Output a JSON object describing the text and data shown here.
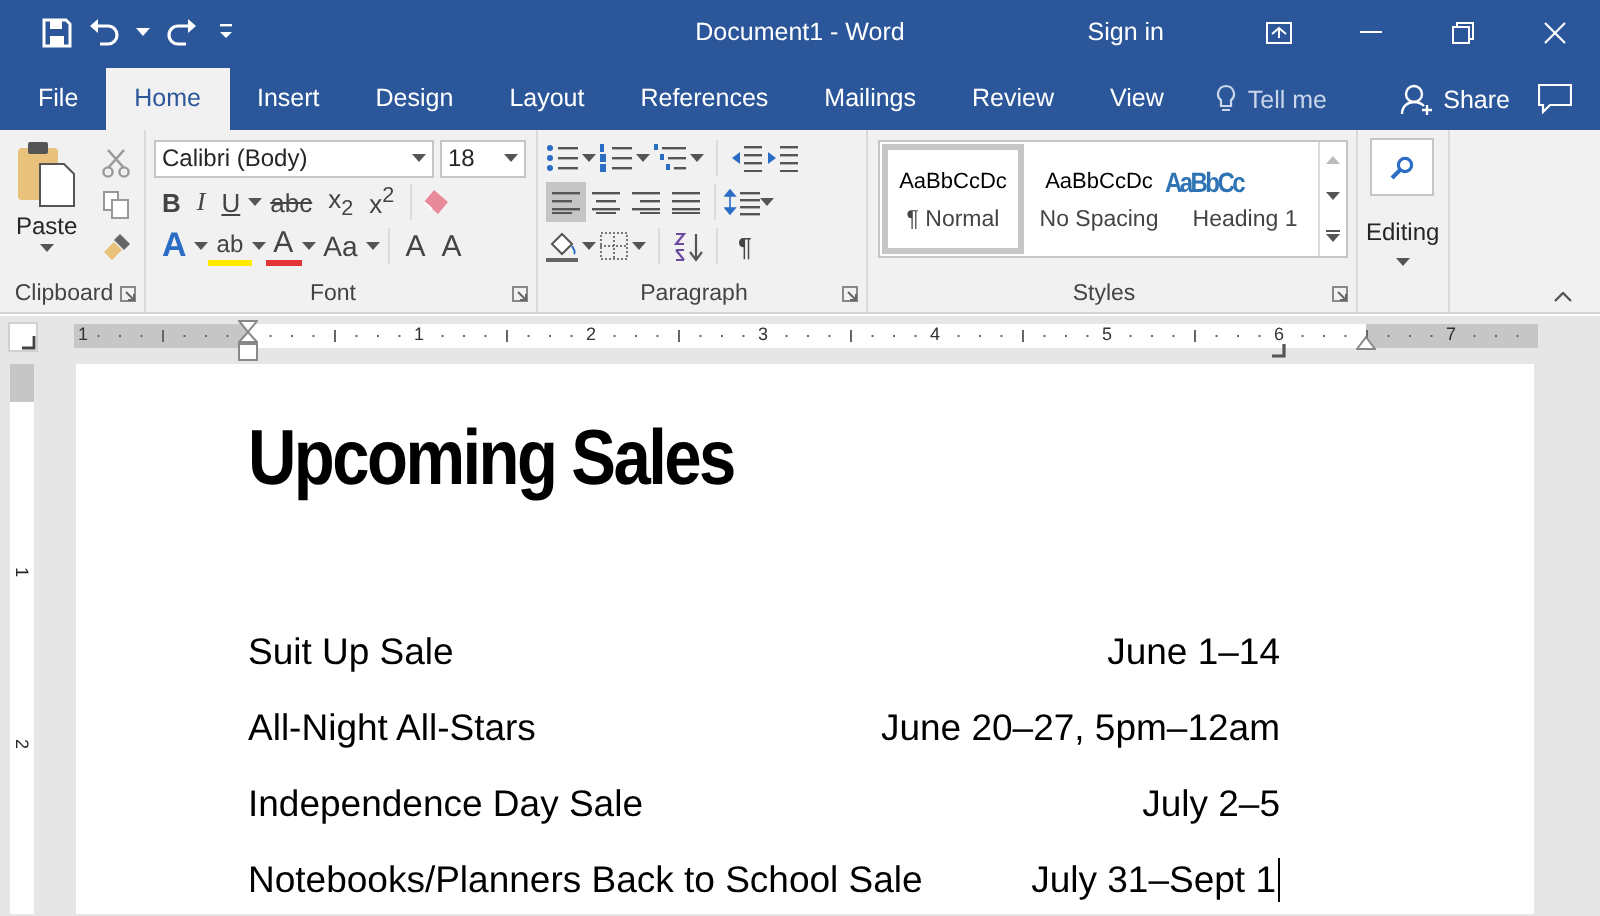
{
  "window": {
    "title": "Document1 - Word",
    "sign_in": "Sign in"
  },
  "tabs": [
    {
      "label": "File",
      "selected": false
    },
    {
      "label": "Home",
      "selected": true
    },
    {
      "label": "Insert",
      "selected": false
    },
    {
      "label": "Design",
      "selected": false
    },
    {
      "label": "Layout",
      "selected": false
    },
    {
      "label": "References",
      "selected": false
    },
    {
      "label": "Mailings",
      "selected": false
    },
    {
      "label": "Review",
      "selected": false
    },
    {
      "label": "View",
      "selected": false
    }
  ],
  "tell_me": "Tell me",
  "share": "Share",
  "ribbon": {
    "clipboard": {
      "label": "Clipboard",
      "paste": "Paste"
    },
    "font": {
      "label": "Font",
      "font_name": "Calibri (Body)",
      "font_size": "18",
      "format_buttons": [
        "B",
        "I",
        "U",
        "abc",
        "x$_{2}$",
        "x$^{2}$"
      ],
      "effects": "A",
      "highlight": "ab",
      "font_color": "A",
      "change_case": "Aa",
      "grow": "A",
      "shrink": "A"
    },
    "paragraph": {
      "label": "Paragraph",
      "alignments": [
        {
          "selected": true
        },
        {
          "selected": false
        },
        {
          "selected": false
        },
        {
          "selected": false
        }
      ],
      "show_marks": "¶"
    },
    "styles": {
      "label": "Styles",
      "items": [
        {
          "preview": "AaBbCcDc",
          "name": "¶ Normal",
          "selected": true,
          "kind": "body"
        },
        {
          "preview": "AaBbCcDc",
          "name": "No Spacing",
          "selected": false,
          "kind": "body"
        },
        {
          "preview": "AaBbCc",
          "name": "Heading 1",
          "selected": false,
          "kind": "heading"
        }
      ]
    },
    "editing": {
      "label": "Editing"
    }
  },
  "ruler": {
    "labels": [
      "1",
      "1",
      "2",
      "3",
      "4",
      "5",
      "6",
      "7"
    ]
  },
  "vertical_ruler": {
    "labels": [
      "1",
      "2"
    ]
  },
  "document": {
    "heading": "Upcoming Sales",
    "rows": [
      {
        "name": "Suit Up Sale",
        "dates": "June 1–14",
        "cursor": false
      },
      {
        "name": "All-Night All-Stars",
        "dates": "June 20–27, 5pm–12am",
        "cursor": false
      },
      {
        "name": "Independence Day Sale",
        "dates": "July 2–5",
        "cursor": false
      },
      {
        "name": "Notebooks/Planners Back to School Sale",
        "dates": "July 31–Sept 1",
        "cursor": true
      }
    ]
  }
}
